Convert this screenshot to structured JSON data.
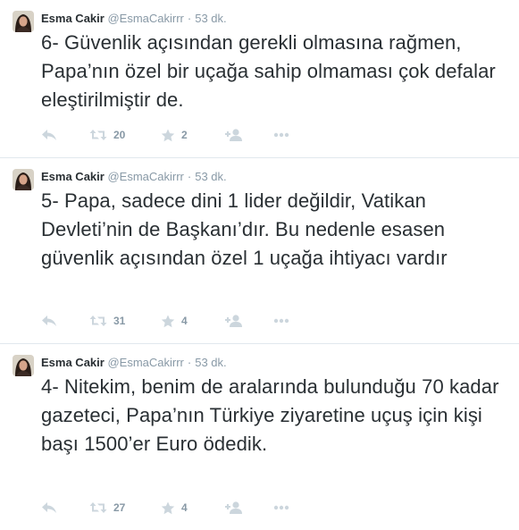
{
  "tweets": [
    {
      "fullname": "Esma Cakir",
      "handle": "@EsmaCakirrr",
      "separator": "·",
      "time": "53 dk.",
      "text": "6- Güvenlik açısından gerekli olmasına rağmen, Papa’nın özel bir uçağa sahip olmaması çok defalar eleştirilmiştir de.",
      "retweets": "20",
      "favorites": "2"
    },
    {
      "fullname": "Esma Cakir",
      "handle": "@EsmaCakirrr",
      "separator": "·",
      "time": "53 dk.",
      "text": "5- Papa, sadece dini 1 lider değildir, Vatikan Devleti’nin de Başkanı’dır. Bu nedenle esasen güvenlik açısından özel 1 uçağa ihtiyacı vardır",
      "retweets": "31",
      "favorites": "4"
    },
    {
      "fullname": "Esma Cakir",
      "handle": "@EsmaCakirrr",
      "separator": "·",
      "time": "53 dk.",
      "text": "4- Nitekim, benim de aralarında bulunduğu 70 kadar gazeteci, Papa’nın Türkiye ziyaretine uçuş için kişi başı 1500’er Euro ödedik.",
      "retweets": "27",
      "favorites": "4"
    }
  ],
  "icons": {
    "reply": "reply-icon",
    "retweet": "retweet-icon",
    "favorite": "star-icon",
    "follow": "follow-icon",
    "more": "more-icon"
  },
  "colors": {
    "text": "#292f33",
    "muted": "#8899a6",
    "icon": "#ccd6dd",
    "divider": "#e1e8ed"
  }
}
